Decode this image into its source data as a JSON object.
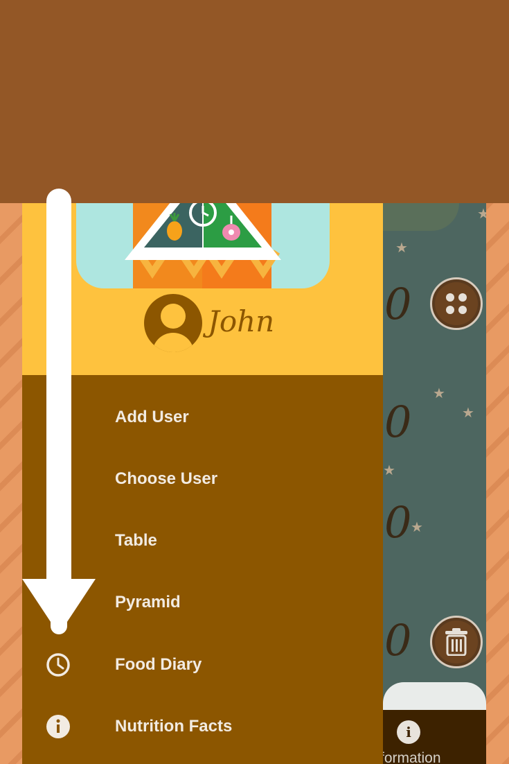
{
  "drawer": {
    "user_name": "John",
    "menu_items": [
      {
        "label": "Add User",
        "icon": "add-user-icon"
      },
      {
        "label": "Choose User",
        "icon": "choose-user-icon"
      },
      {
        "label": "Table",
        "icon": "table-icon"
      },
      {
        "label": "Pyramid",
        "icon": "pyramid-icon"
      },
      {
        "label": "Food Diary",
        "icon": "clock-icon"
      },
      {
        "label": "Nutrition Facts",
        "icon": "info-icon"
      }
    ]
  },
  "background_app": {
    "values": [
      "0",
      "0",
      "0",
      "0"
    ],
    "bottom_nav_label": "formation"
  },
  "colors": {
    "top_band": "#935726",
    "drawer_background": "#8c5600",
    "drawer_header": "#fec23e",
    "menu_text": "#f2ebe2",
    "arrow": "#ffffff"
  }
}
